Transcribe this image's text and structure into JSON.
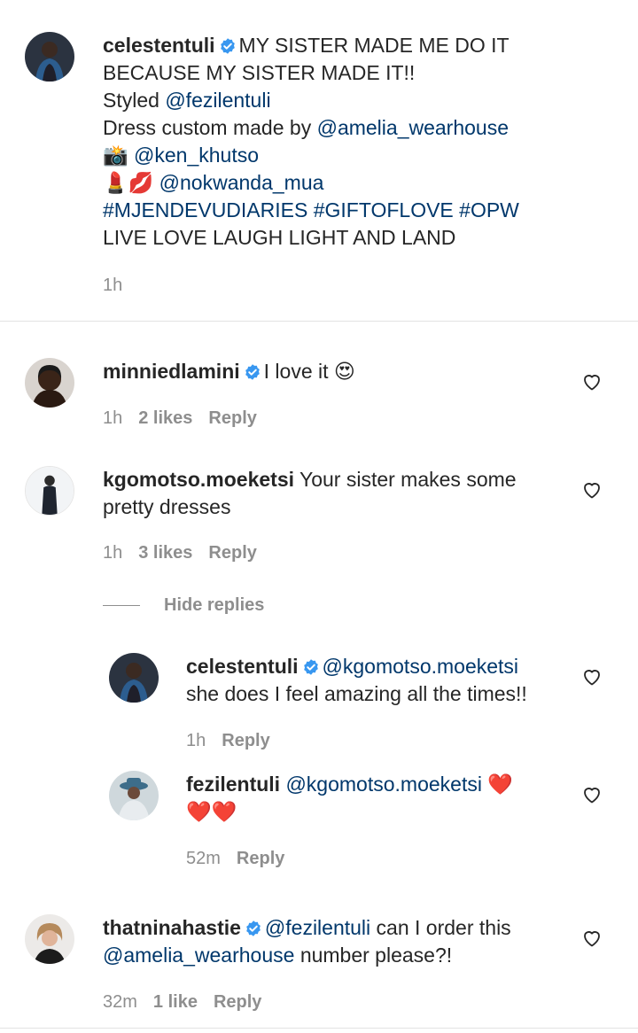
{
  "caption": {
    "username": "celestentuli",
    "line1_text": "MY SISTER MADE ME DO IT",
    "line2": "BECAUSE MY SISTER MADE IT!!",
    "line3_prefix": "Styled ",
    "line3_link": "@fezilentuli",
    "line4_prefix": "Dress custom made by ",
    "line4_link": "@amelia_wearhouse",
    "line5_emoji": "📸",
    "line5_link": "@ken_khutso",
    "line6_emoji": "💄💋",
    "line6_link": "@nokwanda_mua",
    "hashtags": "#MJENDEVUDIARIES #GIFTOFLOVE #OPW",
    "line8": "LIVE LOVE LAUGH LIGHT AND LAND",
    "time": "1h"
  },
  "comments": [
    {
      "username": "minniedlamini",
      "text": "I love it",
      "emoji": "😍",
      "time": "1h",
      "likes": "2 likes",
      "reply_label": "Reply"
    },
    {
      "username": "kgomotso.moeketsi",
      "text_line1": "Your sister makes some",
      "text_line2": "pretty dresses",
      "time": "1h",
      "likes": "3 likes",
      "reply_label": "Reply",
      "hide_replies_label": "Hide replies",
      "replies": [
        {
          "username": "celestentuli",
          "mention": "@kgomotso.moeketsi",
          "text_line2": "she does I feel amazing all the times!!",
          "time": "1h",
          "reply_label": "Reply"
        },
        {
          "username": "fezilentuli",
          "mention": "@kgomotso.moeketsi",
          "emoji_line1": "❤️",
          "emoji_line2": "❤️❤️",
          "time": "52m",
          "reply_label": "Reply"
        }
      ]
    },
    {
      "username": "thatninahastie",
      "mention": "@fezilentuli",
      "text_line1_rest": "can I order this",
      "mention2": "@amelia_wearhouse",
      "text_line2_rest": "number please?!",
      "time": "32m",
      "likes": "1 like",
      "reply_label": "Reply"
    }
  ],
  "icons": {
    "verified": "verified-badge-icon",
    "heart": "heart-outline-icon"
  },
  "colors": {
    "link": "#00376b",
    "verified": "#3897f0",
    "meta": "#8e8e8e",
    "heart_red": "#ed1c2e"
  }
}
